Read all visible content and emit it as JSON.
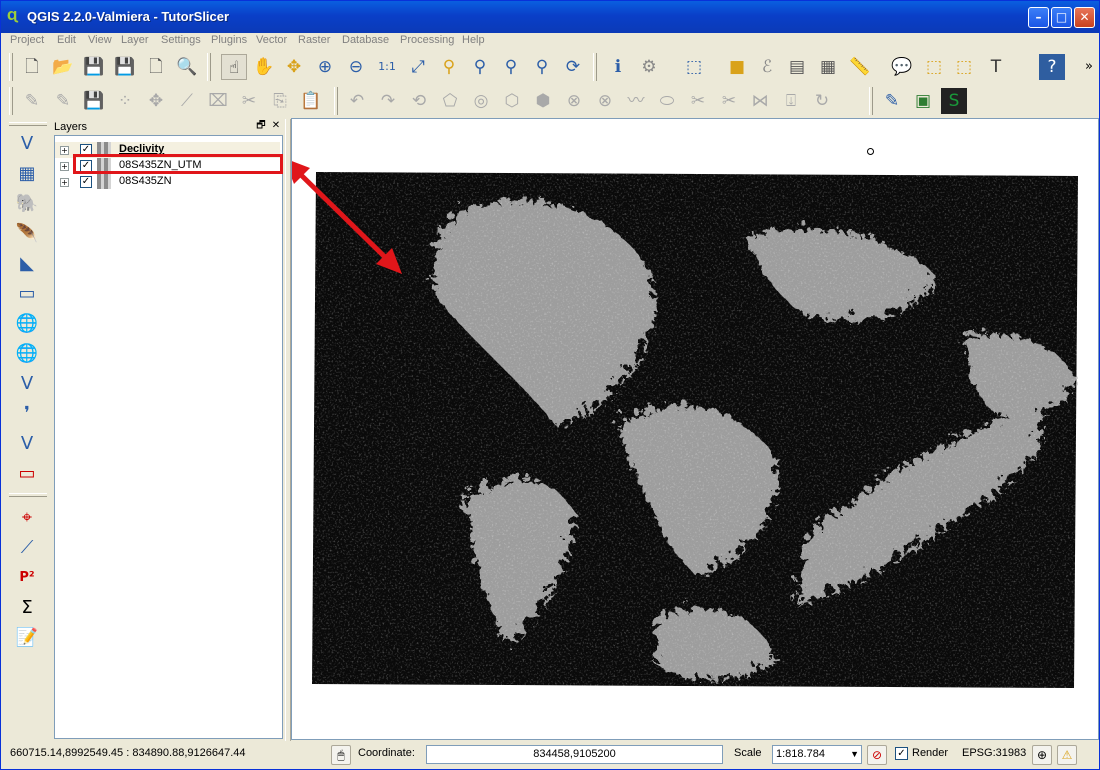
{
  "window": {
    "title": "QGIS 2.2.0-Valmiera - TutorSlicer",
    "minimize_glyph": "–",
    "maximize_glyph": "□",
    "close_glyph": "✕"
  },
  "menubar": {
    "items": [
      "Project",
      "Edit",
      "View",
      "Layer",
      "Settings",
      "Plugins",
      "Vector",
      "Raster",
      "Database",
      "Processing",
      "Help"
    ]
  },
  "toolbar_overflow": "»",
  "layers_panel": {
    "title": "Layers",
    "float_glyph": "🗗",
    "close_glyph": "✕",
    "items": [
      {
        "name": "Declivity",
        "checked_glyph": "✓",
        "expand_glyph": "+"
      },
      {
        "name": "08S435ZN_UTM",
        "checked_glyph": "✓",
        "expand_glyph": "+"
      },
      {
        "name": "08S435ZN",
        "checked_glyph": "✓",
        "expand_glyph": "+"
      }
    ]
  },
  "statusbar": {
    "extent": "660715.14,8992549.45 : 834890.88,9126647.44",
    "coordinate_label": "Coordinate:",
    "coordinate_value": "834458,9105200",
    "scale_label": "Scale",
    "scale_value": "1:818.784",
    "render_label": "Render",
    "render_checked_glyph": "✓",
    "crs": "EPSG:31983"
  },
  "colors": {
    "titlebar": "#0a3fc8",
    "highlight_box": "#e0161a",
    "arrow": "#e0161a"
  }
}
